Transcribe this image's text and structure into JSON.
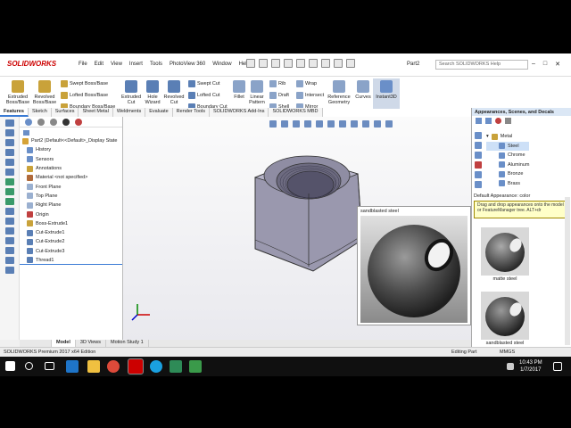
{
  "app": {
    "logo": "SOLIDWORKS",
    "menu": [
      "File",
      "Edit",
      "View",
      "Insert",
      "Tools",
      "PhotoView 360",
      "Window",
      "Help"
    ],
    "document_name": "Part2",
    "search_placeholder": "Search SOLIDWORKS Help"
  },
  "ribbon": {
    "large_buttons": [
      {
        "label": "Extruded Boss/Base",
        "color": "#c9a23a"
      },
      {
        "label": "Revolved Boss/Base",
        "color": "#c9a23a"
      },
      {
        "label": "Extruded Cut",
        "color": "#5a7fb5"
      },
      {
        "label": "Hole Wizard",
        "color": "#5a7fb5"
      },
      {
        "label": "Revolved Cut",
        "color": "#5a7fb5"
      },
      {
        "label": "Fillet",
        "color": "#8aa3c8"
      },
      {
        "label": "Linear Pattern",
        "color": "#8aa3c8"
      },
      {
        "label": "Reference Geometry",
        "color": "#8aa3c8"
      },
      {
        "label": "Curves",
        "color": "#8aa3c8"
      },
      {
        "label": "Instant3D",
        "color": "#6a8fc8"
      }
    ],
    "small_buttons": [
      {
        "label": "Swept Boss/Base"
      },
      {
        "label": "Lofted Boss/Base"
      },
      {
        "label": "Boundary Boss/Base"
      },
      {
        "label": "Swept Cut"
      },
      {
        "label": "Lofted Cut"
      },
      {
        "label": "Boundary Cut"
      },
      {
        "label": "Rib"
      },
      {
        "label": "Draft"
      },
      {
        "label": "Shell"
      },
      {
        "label": "Wrap"
      },
      {
        "label": "Intersect"
      },
      {
        "label": "Mirror"
      }
    ]
  },
  "tabs": [
    "Features",
    "Sketch",
    "Surfaces",
    "Sheet Metal",
    "Weldments",
    "Evaluate",
    "Render Tools",
    "SOLIDWORKS Add-Ins",
    "SOLIDWORKS MBD"
  ],
  "active_tab": "Features",
  "tree": {
    "root": "Part2 (Default<<Default>_Display State",
    "items": [
      "History",
      "Sensors",
      "Annotations",
      "Material <not specified>",
      "Front Plane",
      "Top Plane",
      "Right Plane",
      "Origin",
      "Boss-Extrude1",
      "Cut-Extrude1",
      "Cut-Extrude2",
      "Cut-Extrude3",
      "Thread1"
    ]
  },
  "viewport": {
    "preview_label": "sandblasted steel"
  },
  "bottom_tabs": [
    "Model",
    "3D Views",
    "Motion Study 1"
  ],
  "appearances": {
    "title": "Appearances, Scenes, and Decals",
    "root": "Metal",
    "items": [
      "Steel",
      "Chrome",
      "Aluminum",
      "Bronze",
      "Brass"
    ],
    "selected": "Steel",
    "header": "Default Appearance: color",
    "tip": "Drag and drop appearances onto the model or FeatureManager tree.  ALT+dr",
    "thumbs": [
      "matte steel",
      "sandblasted steel"
    ]
  },
  "status": {
    "left": "SOLIDWORKS Premium 2017 x64 Edition",
    "mode": "Editing Part",
    "units": "MMGS"
  },
  "clock": {
    "time": "10:43 PM",
    "date": "1/7/2017"
  }
}
